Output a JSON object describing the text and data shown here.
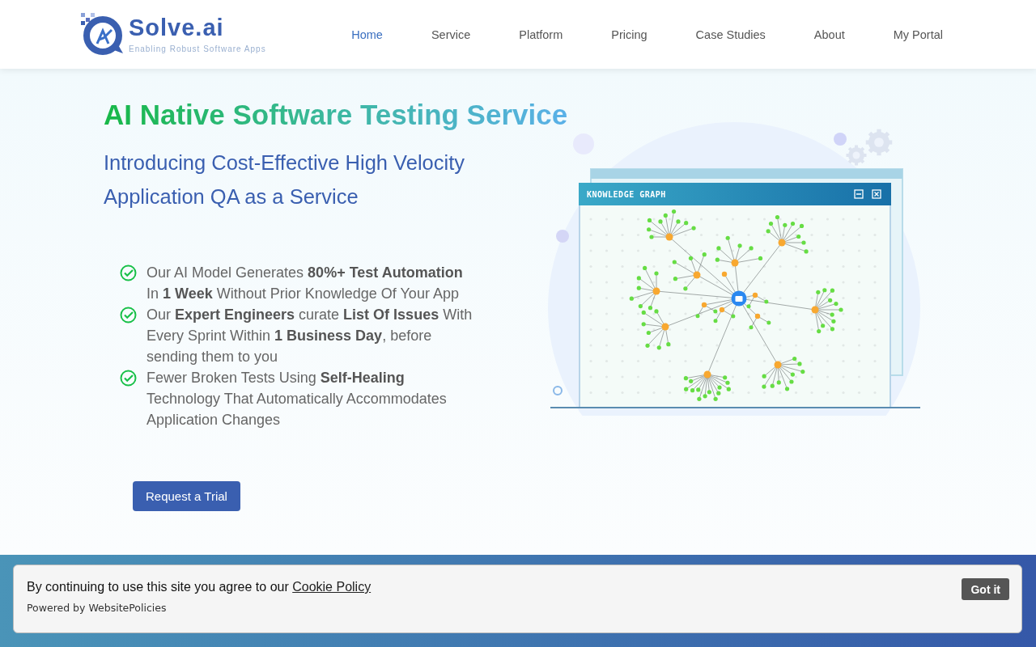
{
  "header": {
    "logo": {
      "name": "Solve.ai",
      "tagline": "Enabling Robust Software Apps"
    },
    "nav": [
      {
        "label": "Home",
        "selected": true
      },
      {
        "label": "Service",
        "selected": false
      },
      {
        "label": "Platform",
        "selected": false
      },
      {
        "label": "Pricing",
        "selected": false
      },
      {
        "label": "Case Studies",
        "selected": false
      },
      {
        "label": "About",
        "selected": false
      },
      {
        "label": "My Portal",
        "selected": false
      }
    ]
  },
  "hero": {
    "title": "AI Native Software Testing Service",
    "subtitle": "Introducing Cost-Effective High Velocity Application QA as a Service",
    "features": [
      "Our AI Model Generates **80%+ Test Automation** In **1 Week** Without Prior Knowledge Of Your App",
      "Our **Expert Engineers** curate **List Of Issues** With Every Sprint Within **1 Business Day**, before sending them to you",
      "Fewer Broken Tests Using **Self-Healing** Technology That Automatically Accommodates Application Changes"
    ],
    "button": "Request a Trial",
    "illustration": {
      "window_title": "KNOWLEDGE GRAPH"
    }
  },
  "cookie_banner": {
    "message": "By continuing to use this site you agree to our",
    "link": "Cookie Policy",
    "powered_by": "Powered by WebsitePolicies",
    "button": "Got it"
  }
}
